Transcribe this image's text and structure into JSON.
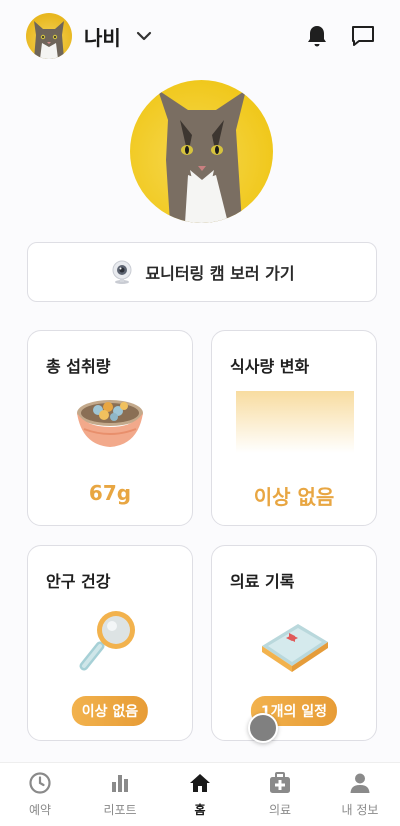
{
  "header": {
    "pet_name": "나비"
  },
  "monitor": {
    "label": "묘니터링 캠 보러 가기"
  },
  "cards": {
    "intake": {
      "title": "총 섭취량",
      "value": "67g"
    },
    "meal_change": {
      "title": "식사량 변화",
      "value": "이상 없음"
    },
    "eye_health": {
      "title": "안구 건강",
      "badge": "이상 없음"
    },
    "medical": {
      "title": "의료 기록",
      "badge": "1개의 일정"
    }
  },
  "nav": [
    {
      "label": "예약",
      "icon": "clock-icon"
    },
    {
      "label": "리포트",
      "icon": "bar-chart-icon"
    },
    {
      "label": "홈",
      "icon": "home-icon"
    },
    {
      "label": "의료",
      "icon": "medical-kit-icon"
    },
    {
      "label": "내 정보",
      "icon": "person-icon"
    }
  ],
  "colors": {
    "accent": "#e8a642",
    "pill_gradient_start": "#f2b24d",
    "pill_gradient_end": "#e79c36",
    "cat_background": "#f0c719"
  }
}
